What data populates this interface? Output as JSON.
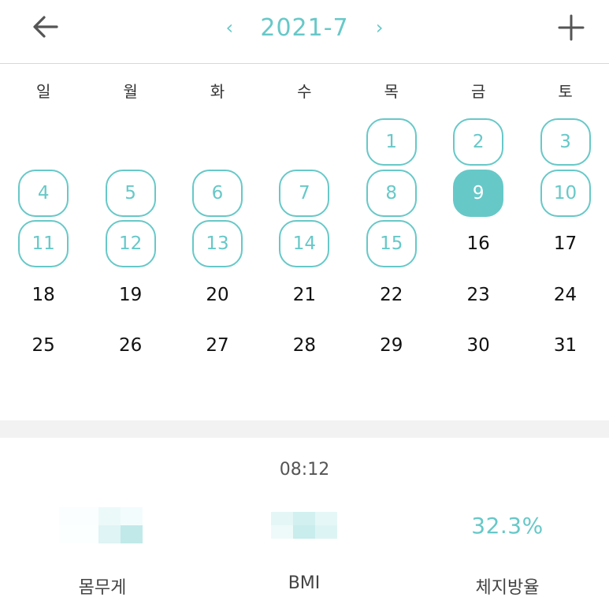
{
  "header": {
    "month_title": "2021-7",
    "prev_arrow": "‹",
    "next_arrow": "›"
  },
  "calendar": {
    "weekdays": [
      "일",
      "월",
      "화",
      "수",
      "목",
      "금",
      "토"
    ],
    "first_weekday_index": 4,
    "days_in_month": 31,
    "selected_day": 9,
    "recorded_days": [
      1,
      2,
      3,
      4,
      5,
      6,
      7,
      8,
      10,
      11,
      12,
      13,
      14,
      15
    ]
  },
  "summary": {
    "time": "08:12",
    "metrics": [
      {
        "label": "몸무게",
        "value": "",
        "value_hidden": true
      },
      {
        "label": "BMI",
        "value": "",
        "value_hidden": true
      },
      {
        "label": "체지방율",
        "value": "32.3%",
        "value_hidden": false
      }
    ]
  },
  "colors": {
    "accent": "#67c8c8",
    "text": "#111111",
    "divider": "#f2f2f2"
  },
  "icons": {
    "back": "arrow-left-icon",
    "add": "plus-icon",
    "prev": "chevron-left-icon",
    "next": "chevron-right-icon"
  }
}
